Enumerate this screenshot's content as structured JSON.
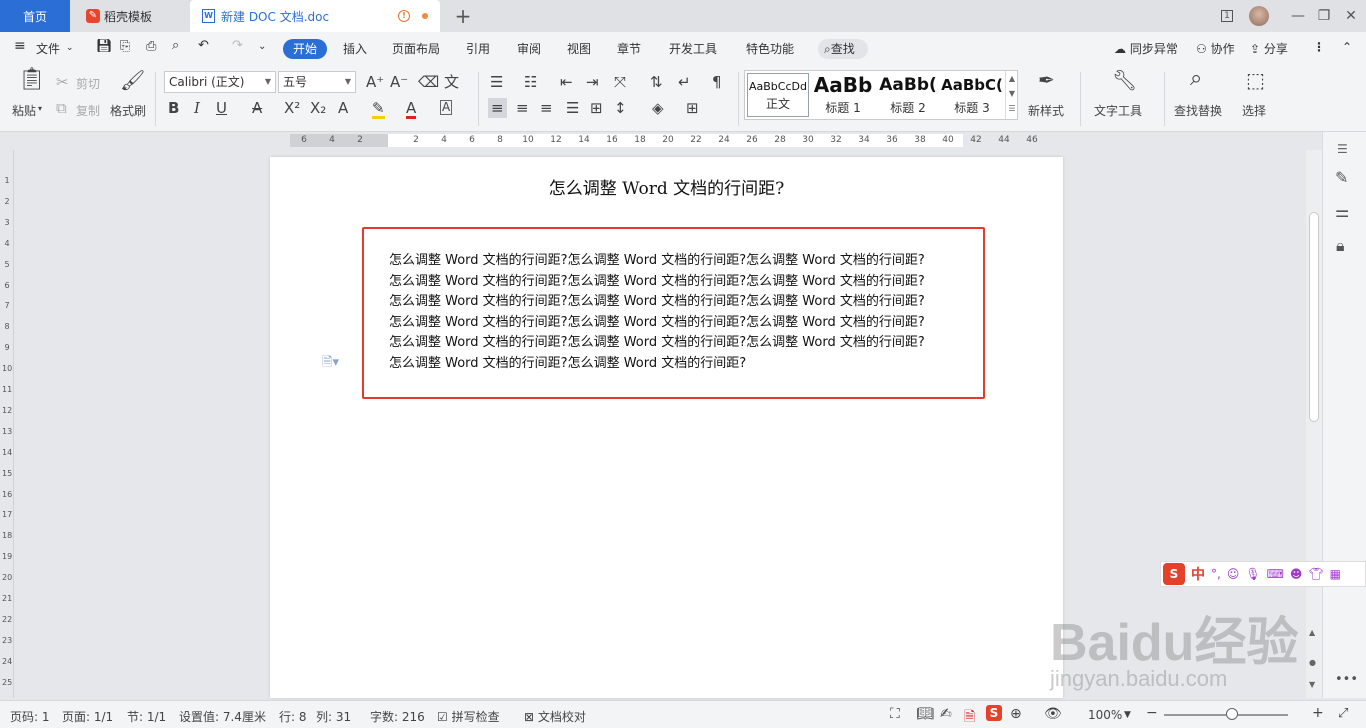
{
  "titlebar": {
    "tabs": [
      {
        "label": "首页"
      },
      {
        "label": "稻壳模板"
      },
      {
        "label": "新建 DOC 文档.doc"
      }
    ],
    "badge": "1"
  },
  "menu": {
    "file": "文件",
    "items": [
      "开始",
      "插入",
      "页面布局",
      "引用",
      "审阅",
      "视图",
      "章节",
      "开发工具",
      "特色功能"
    ],
    "search": "查找",
    "right": [
      "同步异常",
      "协作",
      "分享"
    ]
  },
  "ribbon": {
    "paste": "粘贴",
    "cut": "剪切",
    "copy": "复制",
    "format_painter": "格式刷",
    "font": "Calibri (正文)",
    "size": "五号",
    "styles": [
      {
        "sample": "AaBbCcDd",
        "name": "正文"
      },
      {
        "sample": "AaBb",
        "name": "标题 1"
      },
      {
        "sample": "AaBb(",
        "name": "标题 2"
      },
      {
        "sample": "AaBbC(",
        "name": "标题 3"
      }
    ],
    "new_style": "新样式",
    "text_tools": "文字工具",
    "find_replace": "查找替换",
    "select": "选择"
  },
  "ruler": {
    "h": [
      "6",
      "4",
      "2",
      "",
      "2",
      "4",
      "6",
      "8",
      "10",
      "12",
      "14",
      "16",
      "18",
      "20",
      "22",
      "24",
      "26",
      "28",
      "30",
      "32",
      "34",
      "36",
      "38",
      "40",
      "42",
      "44",
      "46"
    ],
    "v": [
      "1",
      "2",
      "3",
      "4",
      "5",
      "6",
      "7",
      "8",
      "9",
      "10",
      "11",
      "12",
      "13",
      "14",
      "15",
      "16",
      "17",
      "18",
      "19",
      "20",
      "21",
      "22",
      "23",
      "24",
      "25"
    ]
  },
  "document": {
    "title": "怎么调整 Word 文档的行间距?",
    "lines": [
      "怎么调整 Word 文档的行间距?怎么调整 Word 文档的行间距?怎么调整 Word 文档的行间距?",
      "怎么调整 Word 文档的行间距?怎么调整 Word 文档的行间距?怎么调整 Word 文档的行间距?",
      "怎么调整 Word 文档的行间距?怎么调整 Word 文档的行间距?怎么调整 Word 文档的行间距?",
      "怎么调整 Word 文档的行间距?怎么调整 Word 文档的行间距?怎么调整 Word 文档的行间距?",
      "怎么调整 Word 文档的行间距?怎么调整 Word 文档的行间距?怎么调整 Word 文档的行间距?",
      "怎么调整 Word 文档的行间距?怎么调整 Word 文档的行间距?"
    ]
  },
  "ime": {
    "label": "中"
  },
  "status": {
    "page_code": "页码: 1",
    "page": "页面: 1/1",
    "section": "节: 1/1",
    "setting": "设置值: 7.4厘米",
    "row": "行: 8",
    "col": "列: 31",
    "words": "字数: 216",
    "spell": "拼写检查",
    "proof": "文档校对",
    "zoom": "100%"
  },
  "watermark": {
    "brand": "Baidu经验",
    "url": "jingyan.baidu.com"
  },
  "colors": {
    "accent": "#2b6fd6",
    "highlight_border": "#e23a2f"
  }
}
